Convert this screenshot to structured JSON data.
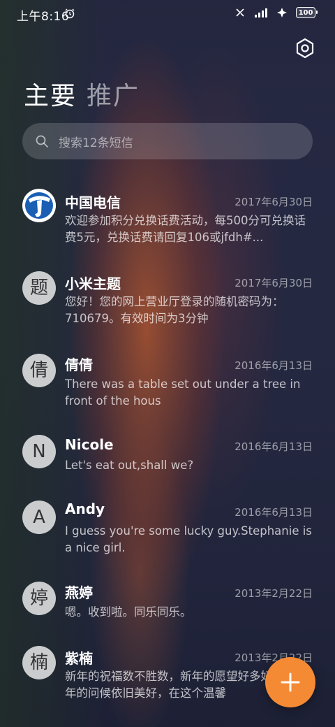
{
  "status_bar": {
    "time": "上午8:16",
    "battery": "100",
    "icons": [
      "alarm-icon",
      "nfc-icon",
      "signal-icon",
      "wifi-icon",
      "battery-icon"
    ]
  },
  "header": {
    "tabs": [
      {
        "label": "主要",
        "active": true
      },
      {
        "label": "推广",
        "active": false
      }
    ],
    "settings_icon": "settings-hex-icon"
  },
  "search": {
    "placeholder": "搜索12条短信"
  },
  "messages": [
    {
      "avatar": "",
      "avatar_type": "china-telecom-logo",
      "sender": "中国电信",
      "date": "2017年6月30日",
      "preview": "欢迎参加积分兑换话费活动，每500分可兑换话费5元，兑换话费请回复106或jfdh#..."
    },
    {
      "avatar": "题",
      "sender": "小米主题",
      "date": "2017年6月30日",
      "preview": "您好！您的网上营业厅登录的随机密码为：710679。有效时间为3分钟"
    },
    {
      "avatar": "倩",
      "sender": "倩倩",
      "date": "2016年6月13日",
      "preview": "There was a table set out under a tree in front of the hous"
    },
    {
      "avatar": "N",
      "sender": "Nicole",
      "date": "2016年6月13日",
      "preview": "Let's eat out,shall we?"
    },
    {
      "avatar": "A",
      "sender": "Andy",
      "date": "2016年6月13日",
      "preview": "I guess you're some lucky guy.Stephanie is a nice girl."
    },
    {
      "avatar": "婷",
      "sender": "燕婷",
      "date": "2013年2月22日",
      "preview": "嗯。收到啦。同乐同乐。"
    },
    {
      "avatar": "楠",
      "sender": "紫楠",
      "date": "2013年2月22日",
      "preview": "新年的祝福数不胜数，新年的愿望好多好多，新年的问候依旧美好，在这个温馨"
    }
  ],
  "fab": {
    "icon": "plus-icon",
    "color": "#f58a35"
  },
  "colors": {
    "accent": "#f58a35",
    "brand_telecom": "#1a5fb4"
  }
}
